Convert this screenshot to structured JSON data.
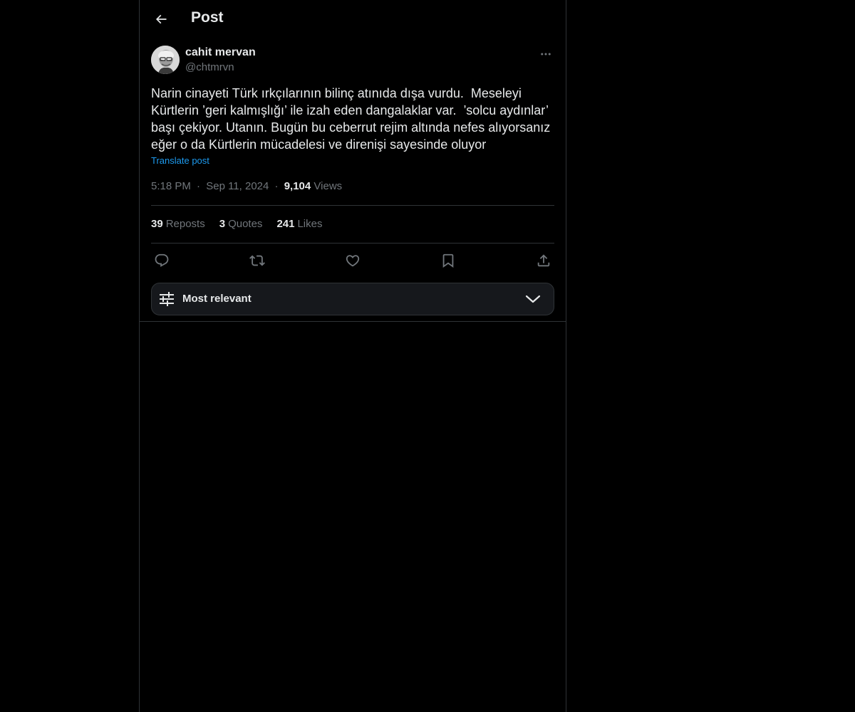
{
  "header": {
    "title": "Post",
    "back_icon": "arrow-left-icon"
  },
  "author": {
    "name": "cahit mervan",
    "handle": "@chtmrvn"
  },
  "post": {
    "text": "Narin cinayeti Türk ırkçılarının bilinç atınıda dışa vurdu.  Meseleyi Kürtlerin ’geri kalmışlığı’ ile izah eden dangalaklar var.  ’solcu aydınlar’ başı çekiyor. Utanın. Bugün bu ceberrut rejim altında nefes alıyorsanız eğer o da Kürtlerin mücadelesi ve direnişi sayesinde oluyor",
    "translate_label": "Translate post",
    "time": "5:18 PM",
    "date": "Sep 11, 2024",
    "views_count": "9,104",
    "views_label": "Views",
    "separator": "·"
  },
  "stats": {
    "reposts_count": "39",
    "reposts_label": "Reposts",
    "quotes_count": "3",
    "quotes_label": "Quotes",
    "likes_count": "241",
    "likes_label": "Likes"
  },
  "actions": [
    "reply-icon",
    "repost-icon",
    "like-icon",
    "bookmark-icon",
    "share-icon"
  ],
  "replies_sort": {
    "label": "Most relevant"
  },
  "colors": {
    "background": "#000000",
    "text": "#e7e9ea",
    "muted": "#71767b",
    "link": "#1d9bf0",
    "border": "#2f3336"
  }
}
